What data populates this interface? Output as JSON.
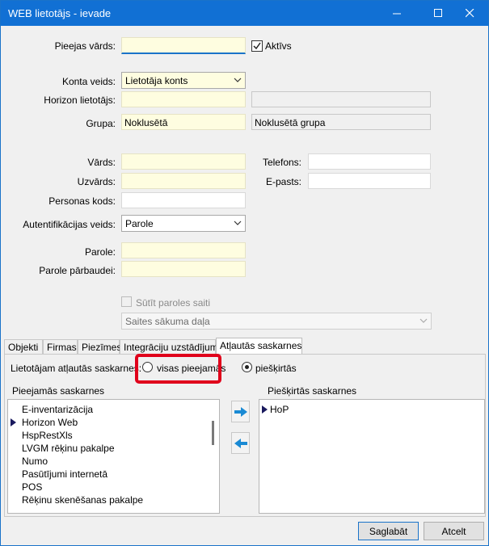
{
  "window": {
    "title": "WEB lietotājs - ievade",
    "minimize_glyph": "—",
    "maximize_glyph": "☐",
    "close_glyph": "✕"
  },
  "form": {
    "login_label": "Pieejas vārds:",
    "login_value": "",
    "active_label": "Aktīvs",
    "active_checked": true,
    "account_type_label": "Konta veids:",
    "account_type_value": "Lietotāja konts",
    "horizon_user_label": "Horizon lietotājs:",
    "horizon_user_value": "",
    "horizon_user_name": "",
    "group_label": "Grupa:",
    "group_value": "Noklusētā",
    "group_name": "Noklusētā grupa",
    "first_name_label": "Vārds:",
    "first_name_value": "",
    "phone_label": "Telefons:",
    "phone_value": "",
    "last_name_label": "Uzvārds:",
    "last_name_value": "",
    "email_label": "E-pasts:",
    "email_value": "",
    "personal_code_label": "Personas kods:",
    "personal_code_value": "",
    "auth_type_label": "Autentifikācijas veids:",
    "auth_type_value": "Parole",
    "password_label": "Parole:",
    "password_value": "",
    "password_confirm_label": "Parole pārbaudei:",
    "password_confirm_value": "",
    "send_link_label": "Sūtīt paroles saiti",
    "start_page_placeholder": "Saites sākuma daļa"
  },
  "tabs": [
    {
      "label": "Objekti"
    },
    {
      "label": "Firmas"
    },
    {
      "label": "Piezīmes"
    },
    {
      "label": "Integrāciju uzstādījumi"
    },
    {
      "label": "Atļautās saskarnes"
    }
  ],
  "panel": {
    "allowed_label": "Lietotājam atļautās saskarnes:",
    "option_all": "visas pieejamās",
    "option_assigned": "piešķirtās",
    "available_header": "Pieejamās saskarnes",
    "assigned_header": "Piešķirtās saskarnes",
    "available_items": [
      "E-inventarizācija",
      "Horizon Web",
      "HspRestXls",
      "LVGM rēķinu pakalpe",
      "Numo",
      "Pasūtījumi internetā",
      "POS",
      "Rēķinu skenēšanas pakalpe"
    ],
    "assigned_items": [
      "HoP"
    ]
  },
  "buttons": {
    "save": "Saglabāt",
    "cancel": "Atcelt"
  },
  "colors": {
    "titlebar": "#1170d4",
    "required_field": "#fefde0",
    "highlight": "#e0001b",
    "arrow": "#1a8ad4"
  }
}
